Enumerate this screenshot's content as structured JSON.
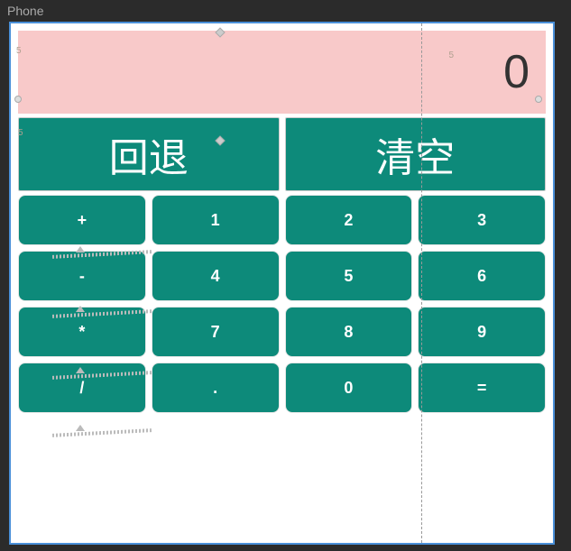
{
  "window": {
    "label": "Phone"
  },
  "display": {
    "value": "0"
  },
  "actions": {
    "backspace": "回退",
    "clear": "清空"
  },
  "keypad": {
    "rows": [
      {
        "c0": "+",
        "c1": "1",
        "c2": "2",
        "c3": "3"
      },
      {
        "c0": "-",
        "c1": "4",
        "c2": "5",
        "c3": "6"
      },
      {
        "c0": "*",
        "c1": "7",
        "c2": "8",
        "c3": "9"
      },
      {
        "c0": "/",
        "c1": ".",
        "c2": "0",
        "c3": "="
      }
    ]
  },
  "margins": {
    "five": "5"
  }
}
